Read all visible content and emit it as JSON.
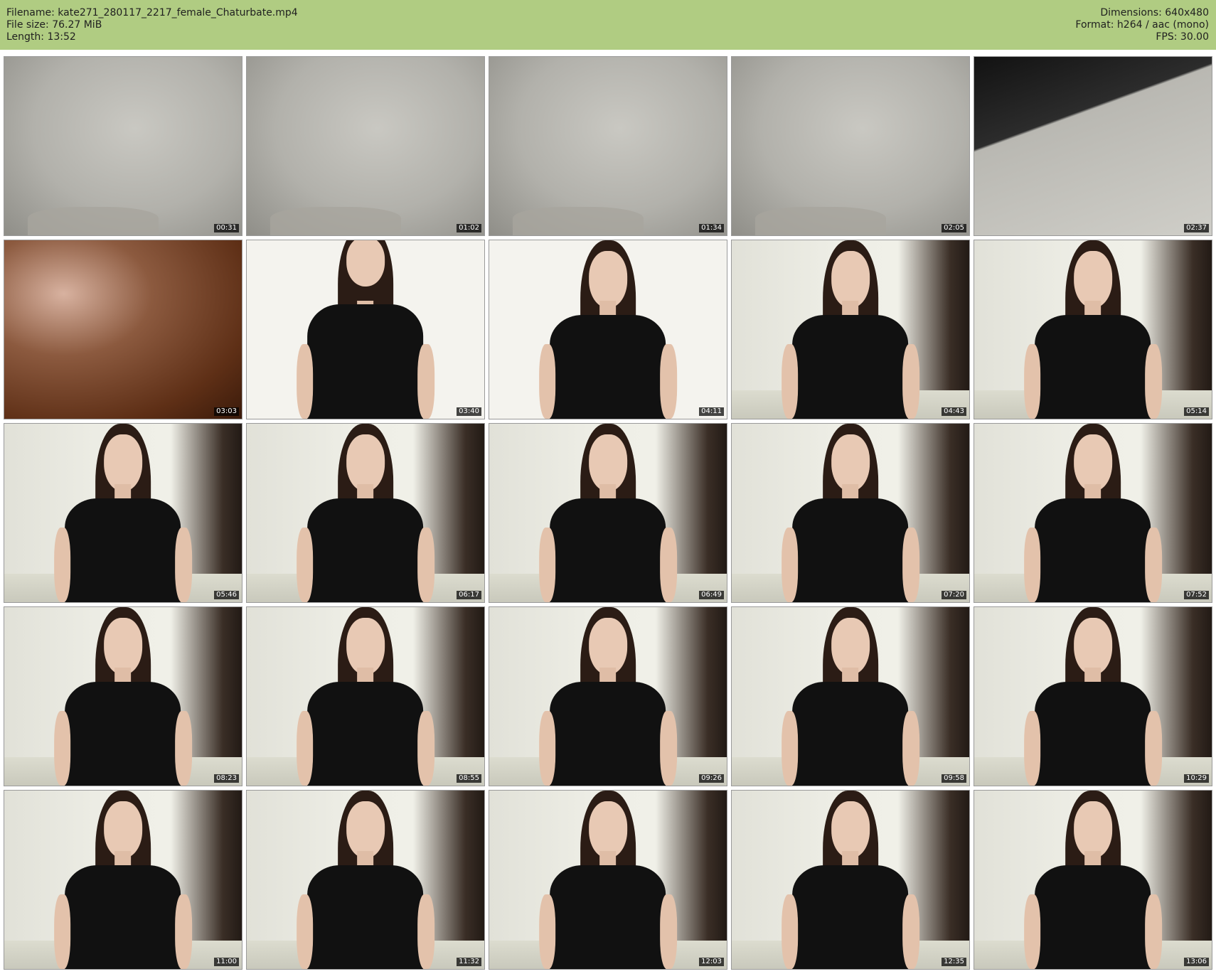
{
  "header": {
    "left_lines": [
      "Filename: kate271_280117_2217_female_Chaturbate.mp4",
      "File size: 76.27 MiB",
      "Length: 13:52"
    ],
    "right_lines": [
      "Dimensions: 640x480",
      "Format: h264 / aac (mono)",
      "FPS: 30.00"
    ],
    "background_color": "#b0cc82"
  },
  "thumbnails": [
    {
      "time": "00:31",
      "scene": "wall"
    },
    {
      "time": "01:02",
      "scene": "wall"
    },
    {
      "time": "01:34",
      "scene": "wall"
    },
    {
      "time": "02:05",
      "scene": "wall"
    },
    {
      "time": "02:37",
      "scene": "dark-arm"
    },
    {
      "time": "03:03",
      "scene": "brown"
    },
    {
      "time": "03:40",
      "scene": "bright-person"
    },
    {
      "time": "04:11",
      "scene": "bright-person"
    },
    {
      "time": "04:43",
      "scene": "room-person"
    },
    {
      "time": "05:14",
      "scene": "room-person"
    },
    {
      "time": "05:46",
      "scene": "room-person"
    },
    {
      "time": "06:17",
      "scene": "room-person"
    },
    {
      "time": "06:49",
      "scene": "room-person"
    },
    {
      "time": "07:20",
      "scene": "room-person"
    },
    {
      "time": "07:52",
      "scene": "room-person"
    },
    {
      "time": "08:23",
      "scene": "room-person"
    },
    {
      "time": "08:55",
      "scene": "room-person"
    },
    {
      "time": "09:26",
      "scene": "room-person"
    },
    {
      "time": "09:58",
      "scene": "room-person"
    },
    {
      "time": "10:29",
      "scene": "room-person"
    },
    {
      "time": "11:00",
      "scene": "room-person"
    },
    {
      "time": "11:32",
      "scene": "room-person"
    },
    {
      "time": "12:03",
      "scene": "room-person"
    },
    {
      "time": "12:35",
      "scene": "room-person"
    },
    {
      "time": "13:06",
      "scene": "room-person"
    }
  ]
}
